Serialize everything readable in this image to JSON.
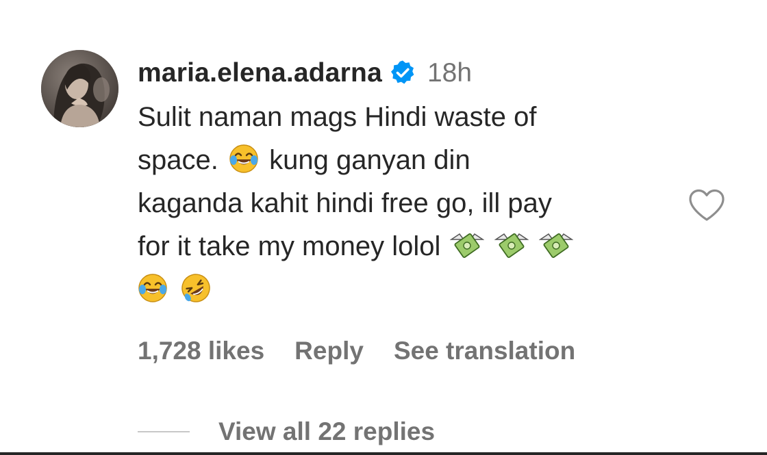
{
  "comment": {
    "username": "maria.elena.adarna",
    "verified": true,
    "timestamp": "18h",
    "lines": [
      "Sulit naman mags Hindi waste of",
      "space.",
      "kung ganyan din",
      "kaganda kahit hindi free go, ill pay",
      "for it take my money lolol"
    ],
    "emojis": {
      "inline_line2": "face-with-tears-of-joy",
      "line4_trailing": [
        "money-with-wings",
        "money-with-wings",
        "money-with-wings"
      ],
      "line5": [
        "face-with-tears-of-joy",
        "rolling-on-the-floor-laughing"
      ]
    },
    "likes_label": "1,728 likes",
    "reply_label": "Reply",
    "translate_label": "See translation",
    "view_replies_label": "View all 22 replies"
  },
  "icons": {
    "avatar": "profile-photo",
    "verified": "verified-badge-icon",
    "like": "heart-outline-icon"
  },
  "colors": {
    "text_primary": "#262626",
    "text_secondary": "#737373",
    "verified_blue": "#0095f6",
    "divider": "#c7c7c7"
  }
}
